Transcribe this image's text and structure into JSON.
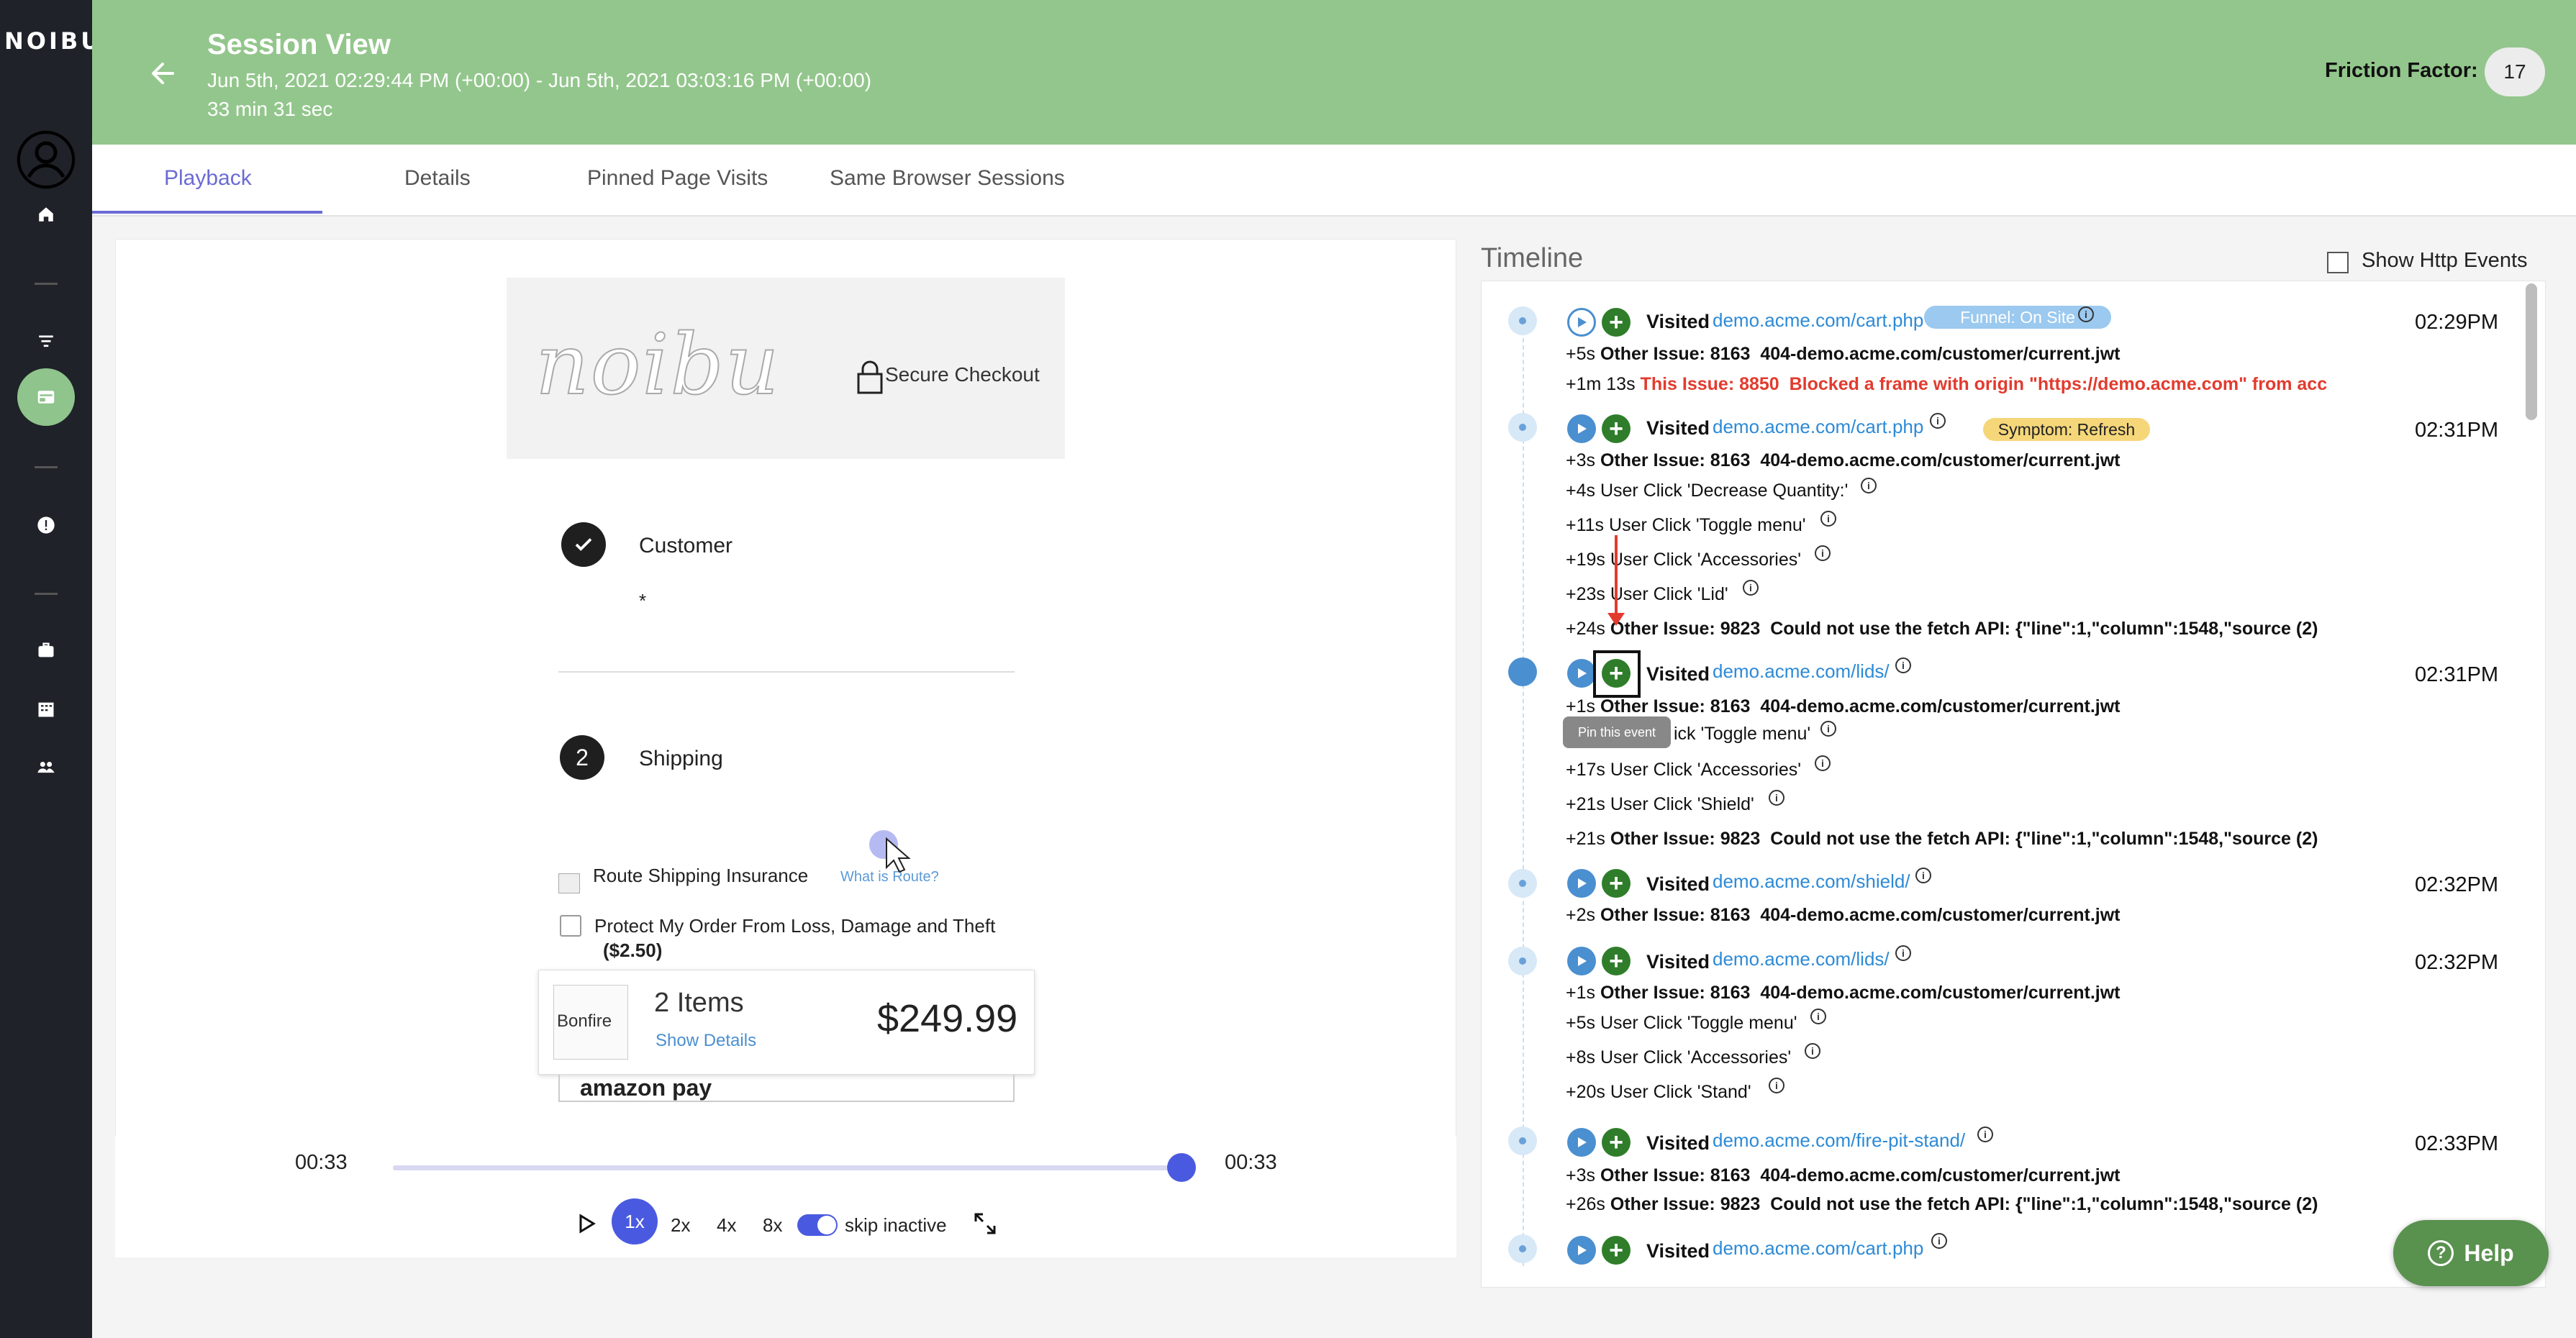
{
  "brand": {
    "logo_text": "NOIBU"
  },
  "header": {
    "title": "Session View",
    "date_range": "Jun 5th, 2021 02:29:44 PM (+00:00) - Jun 5th, 2021 03:03:16 PM (+00:00)",
    "duration": "33 min 31 sec",
    "friction_label": "Friction Factor:",
    "friction_value": "17"
  },
  "tabs": [
    "Playback",
    "Details",
    "Pinned Page Visits",
    "Same Browser Sessions"
  ],
  "checkout": {
    "logo_text": "noibu",
    "secure_label": "Secure Checkout",
    "step1_label": "Customer",
    "step1_value": "*",
    "step2_number": "2",
    "step2_label": "Shipping",
    "route_label": "Route Shipping Insurance",
    "route_link": "What is Route?",
    "protect_label": "Protect My Order From Loss, Damage and Theft",
    "protect_price": "($2.50)",
    "cart_img_alt": "Bonfire",
    "cart_items": "2 Items",
    "cart_details": "Show Details",
    "cart_total": "$249.99",
    "pay_label": "amazon pay"
  },
  "player": {
    "current_time": "00:33",
    "end_time": "00:33",
    "progress": 1.0,
    "speeds": [
      "1x",
      "2x",
      "4x",
      "8x"
    ],
    "skip_label": "skip inactive"
  },
  "timeline": {
    "title": "Timeline",
    "http_label": "Show Http Events",
    "groups": [
      {
        "time": "02:29PM",
        "url": "demo.acme.com/cart.php",
        "badge": "Funnel: On Site",
        "events": [
          {
            "offset": "+5s",
            "kind": "Other Issue: 8163",
            "text": "404-demo.acme.com/customer/current.jwt"
          },
          {
            "offset": "+1m 13s",
            "kind": "This Issue: 8850",
            "text": "Blocked a frame with origin \"https://demo.acme.com\" from acc"
          }
        ]
      },
      {
        "time": "02:31PM",
        "url": "demo.acme.com/cart.php",
        "badge": "Symptom: Refresh",
        "events": [
          {
            "offset": "+3s",
            "kind": "Other Issue: 8163",
            "text": "404-demo.acme.com/customer/current.jwt"
          },
          {
            "offset": "+4s",
            "kind": "",
            "text": "User Click 'Decrease Quantity:'"
          },
          {
            "offset": "+11s",
            "kind": "",
            "text": "User Click 'Toggle menu'"
          },
          {
            "offset": "+19s",
            "kind": "",
            "text": "User Click 'Accessories'"
          },
          {
            "offset": "+23s",
            "kind": "",
            "text": "User Click 'Lid'"
          },
          {
            "offset": "+24s",
            "kind": "Other Issue: 9823",
            "text": "Could not use the fetch API: {\"line\":1,\"column\":1548,\"source (2)"
          }
        ]
      },
      {
        "time": "02:31PM",
        "url": "demo.acme.com/lids/",
        "badge": "",
        "events": [
          {
            "offset": "+1s",
            "kind": "Other Issue: 8163",
            "text": "404-demo.acme.com/customer/current.jwt"
          },
          {
            "offset": "",
            "kind": "",
            "text": "ick 'Toggle menu'"
          },
          {
            "offset": "+17s",
            "kind": "",
            "text": "User Click 'Accessories'"
          },
          {
            "offset": "+21s",
            "kind": "",
            "text": "User Click 'Shield'"
          },
          {
            "offset": "+21s",
            "kind": "Other Issue: 9823",
            "text": "Could not use the fetch API: {\"line\":1,\"column\":1548,\"source (2)"
          }
        ]
      },
      {
        "time": "02:32PM",
        "url": "demo.acme.com/shield/",
        "badge": "",
        "events": [
          {
            "offset": "+2s",
            "kind": "Other Issue: 8163",
            "text": "404-demo.acme.com/customer/current.jwt"
          }
        ]
      },
      {
        "time": "02:32PM",
        "url": "demo.acme.com/lids/",
        "badge": "",
        "events": [
          {
            "offset": "+1s",
            "kind": "Other Issue: 8163",
            "text": "404-demo.acme.com/customer/current.jwt"
          },
          {
            "offset": "+5s",
            "kind": "",
            "text": "User Click 'Toggle menu'"
          },
          {
            "offset": "+8s",
            "kind": "",
            "text": "User Click 'Accessories'"
          },
          {
            "offset": "+20s",
            "kind": "",
            "text": "User Click 'Stand'"
          }
        ]
      },
      {
        "time": "02:33PM",
        "url": "demo.acme.com/fire-pit-stand/",
        "badge": "",
        "events": [
          {
            "offset": "+3s",
            "kind": "Other Issue: 8163",
            "text": "404-demo.acme.com/customer/current.jwt"
          },
          {
            "offset": "+26s",
            "kind": "Other Issue: 9823",
            "text": "Could not use the fetch API: {\"line\":1,\"column\":1548,\"source (2)"
          }
        ]
      },
      {
        "time": "",
        "url": "demo.acme.com/cart.php",
        "badge": "",
        "events": []
      }
    ],
    "visited_label": "Visited",
    "tooltip": "Pin this event"
  },
  "help": {
    "label": "Help"
  },
  "colors": {
    "header_bg": "#93c68c",
    "accent": "#6b6bd4",
    "link": "#2d8ad6",
    "issue_red": "#e23b2e",
    "pin_green": "#2f7d2a"
  }
}
